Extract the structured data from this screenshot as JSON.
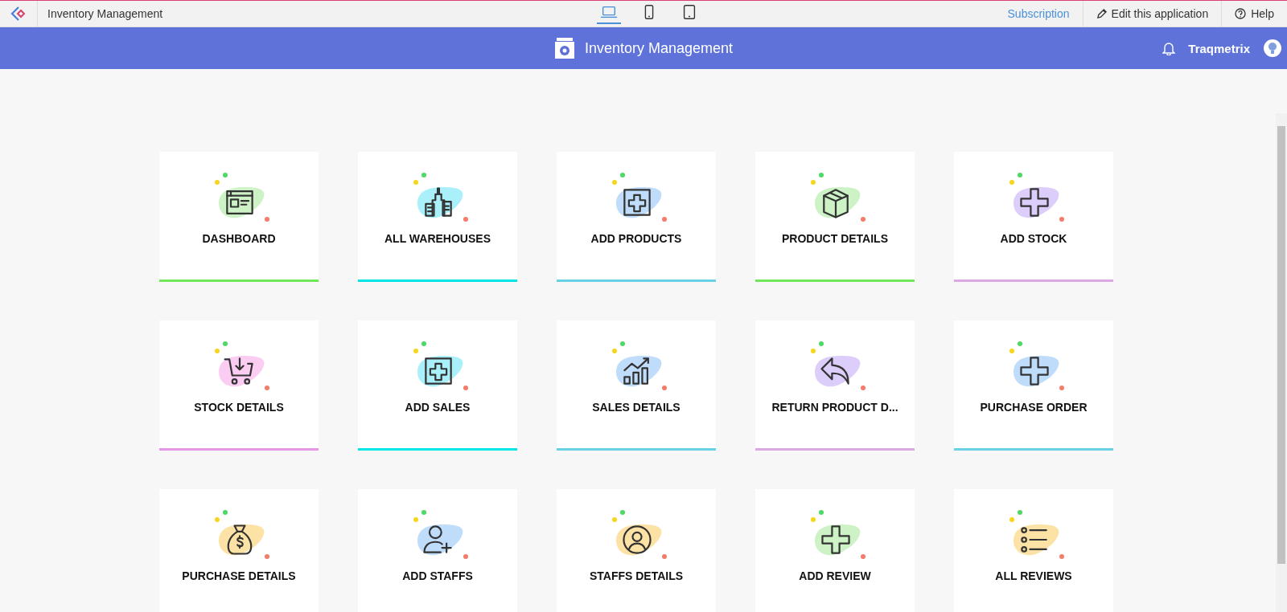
{
  "topbar": {
    "app_title": "Inventory Management",
    "devices": [
      {
        "kind": "laptop",
        "selected": true
      },
      {
        "kind": "phone",
        "selected": false
      },
      {
        "kind": "tablet",
        "selected": false
      }
    ],
    "subscription": "Subscription",
    "edit": "Edit this application",
    "help": "Help"
  },
  "header": {
    "title": "Inventory Management",
    "user": "Traqmetrix"
  },
  "cards": [
    {
      "label": "DASHBOARD",
      "kind": "window",
      "color": "#cdf2c6"
    },
    {
      "label": "ALL WAREHOUSES",
      "kind": "buildings",
      "color": "#a9f0fb"
    },
    {
      "label": "ADD PRODUCTS",
      "kind": "plus-square",
      "color": "#bfdcfb"
    },
    {
      "label": "PRODUCT DETAILS",
      "kind": "box",
      "color": "#cdf2c6"
    },
    {
      "label": "ADD STOCK",
      "kind": "plus",
      "color": "#dccdfb"
    },
    {
      "label": "STOCK DETAILS",
      "kind": "cart",
      "color": "#fbcdf3"
    },
    {
      "label": "ADD SALES",
      "kind": "plus-square",
      "color": "#a9f0fb"
    },
    {
      "label": "SALES DETAILS",
      "kind": "chart",
      "color": "#bfdcfb"
    },
    {
      "label": "RETURN PRODUCT D...",
      "kind": "reply",
      "color": "#dccdfb"
    },
    {
      "label": "PURCHASE ORDER",
      "kind": "plus",
      "color": "#bfdcfb"
    },
    {
      "label": "PURCHASE DETAILS",
      "kind": "moneybag",
      "color": "#fde2a6"
    },
    {
      "label": "ADD STAFFS",
      "kind": "userplus",
      "color": "#bfdcfb"
    },
    {
      "label": "STAFFS DETAILS",
      "kind": "usercircle",
      "color": "#fde2a6"
    },
    {
      "label": "ADD REVIEW",
      "kind": "plus",
      "color": "#cdf2c6"
    },
    {
      "label": "ALL REVIEWS",
      "kind": "list",
      "color": "#fde2a6"
    }
  ]
}
